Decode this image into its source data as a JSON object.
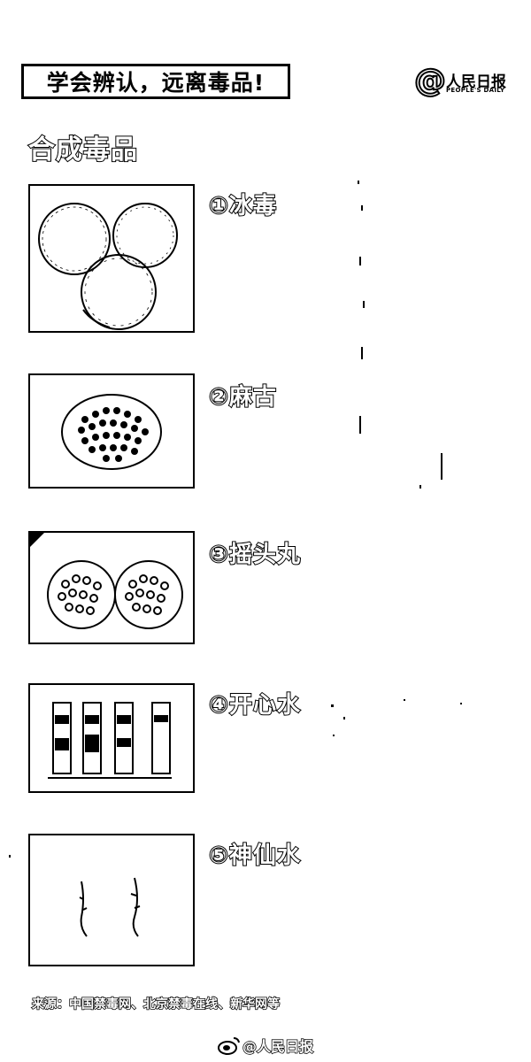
{
  "header": {
    "title": "学会辨认，远离毒品!",
    "logo_at": "@",
    "logo_cn": "人民日报",
    "logo_en": "PEOPLE'S DAILY"
  },
  "section": {
    "title": "合成毒品"
  },
  "items": [
    {
      "label": "①冰毒"
    },
    {
      "label": "②麻古"
    },
    {
      "label": "③摇头丸"
    },
    {
      "label": "④开心水"
    },
    {
      "label": "⑤神仙水"
    }
  ],
  "source_text": "来源：中国禁毒网、北京禁毒在线、新华网等",
  "footer": {
    "handle": "@人民日报",
    "icon": "weibo-icon"
  }
}
